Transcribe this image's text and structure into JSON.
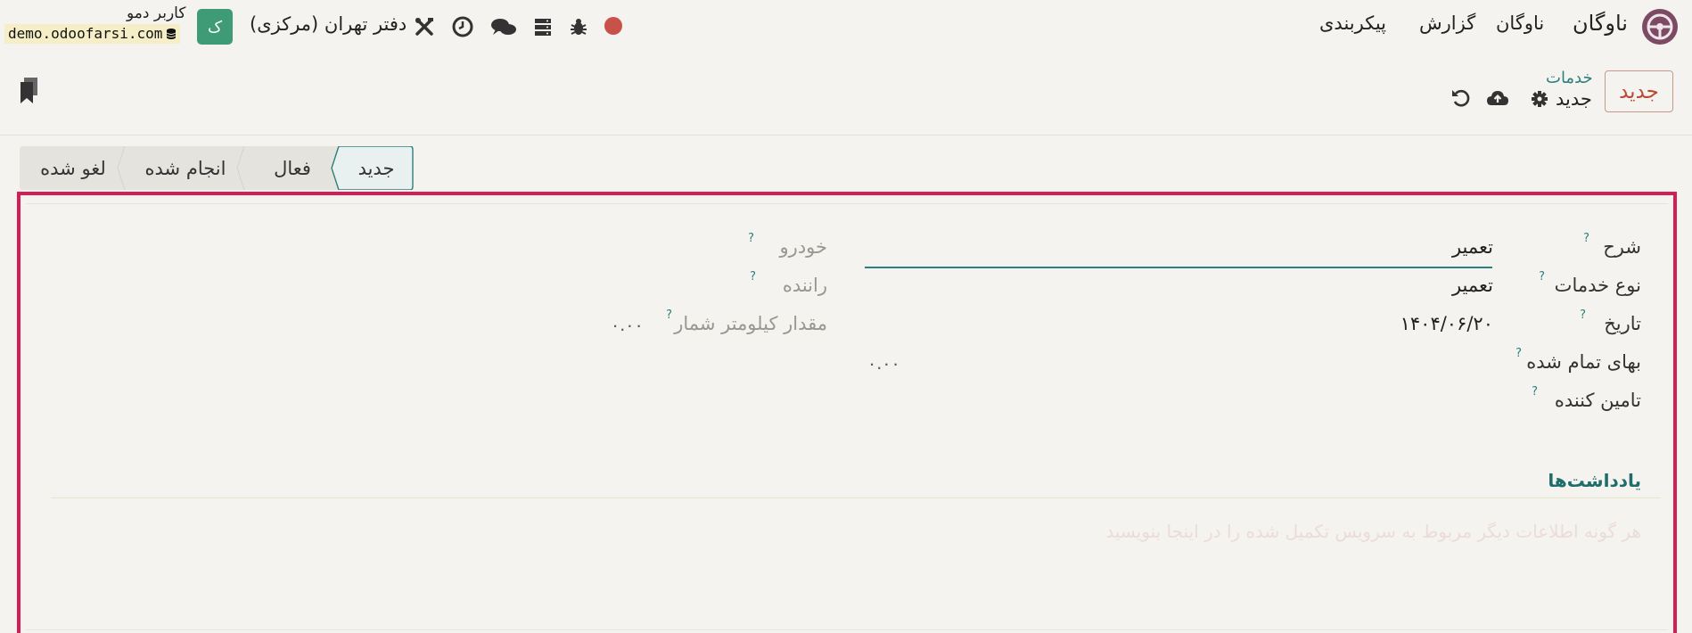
{
  "navbar": {
    "app_name": "ناوگان",
    "menu": [
      "ناوگان",
      "گزارش",
      "پیکربندی"
    ],
    "company": "دفتر تهران (مرکزی)",
    "user_initial": "ک",
    "user_name": "کاربر دمو",
    "database": "demo.odoofarsi.com",
    "icons": [
      "record-dot",
      "bug-icon",
      "server-icon",
      "chat-icon",
      "clock-icon",
      "tools-icon"
    ]
  },
  "control_panel": {
    "new_button": "جدید",
    "breadcrumb_parent": "خدمات",
    "breadcrumb_current": "جدید",
    "icons": [
      "gear-icon",
      "cloud-upload-icon",
      "undo-icon",
      "bookmark-icon"
    ]
  },
  "status_bar": {
    "stages": [
      {
        "label": "جدید",
        "active": true
      },
      {
        "label": "فعال",
        "active": false
      },
      {
        "label": "انجام شده",
        "active": false
      },
      {
        "label": "لغو شده",
        "active": false
      }
    ]
  },
  "form": {
    "help_mark": "?",
    "right_column": [
      {
        "label": "شرح",
        "value": "تعمیر"
      },
      {
        "label": "نوع خدمات",
        "value": "تعمیر"
      },
      {
        "label": "تاریخ",
        "value": "۱۴۰۴/۰۶/۲۰"
      },
      {
        "label": "بهای تمام شده",
        "value": "۰.۰۰"
      },
      {
        "label": "تامین کننده",
        "value": ""
      }
    ],
    "left_column": [
      {
        "label": "خودرو",
        "value": ""
      },
      {
        "label": "راننده",
        "value": ""
      },
      {
        "label": "مقدار کیلومتر شمار",
        "value": "۰.۰۰"
      }
    ],
    "notes_tab": "یادداشت‌ها",
    "notes_placeholder": "هر گونه اطلاعات دیگر مربوط به سرویس تکمیل شده را در اینجا بنویسید"
  },
  "colors": {
    "accent": "#2d7f7c",
    "brand": "#7c4a62",
    "highlight_border": "#d21e55",
    "primary_button_text": "#b84a33"
  }
}
